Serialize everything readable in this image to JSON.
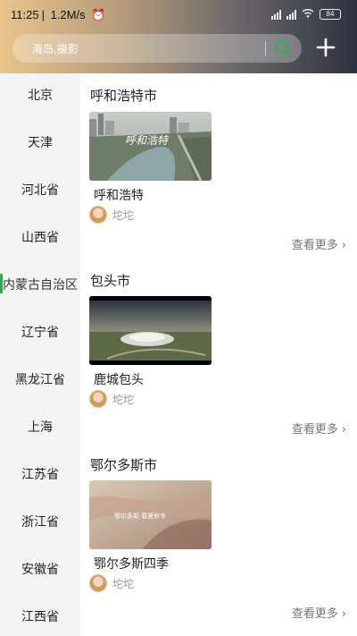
{
  "status": {
    "time": "11:25",
    "speed": "1.2M/s",
    "battery": "84"
  },
  "search": {
    "placeholder": "海岛,摄影"
  },
  "sidebar": {
    "items": [
      {
        "label": "北京"
      },
      {
        "label": "天津"
      },
      {
        "label": "河北省"
      },
      {
        "label": "山西省"
      },
      {
        "label": "内蒙古自治区"
      },
      {
        "label": "辽宁省"
      },
      {
        "label": "黑龙江省"
      },
      {
        "label": "上海"
      },
      {
        "label": "江苏省"
      },
      {
        "label": "浙江省"
      },
      {
        "label": "安徽省"
      },
      {
        "label": "江西省"
      }
    ],
    "active_index": 4
  },
  "sections": [
    {
      "title": "呼和浩特市",
      "card": {
        "title": "呼和浩特",
        "author": "坨坨",
        "thumb_text": "呼和浩特"
      },
      "more": "查看更多"
    },
    {
      "title": "包头市",
      "card": {
        "title": "鹿城包头",
        "author": "坨坨",
        "thumb_text": ""
      },
      "more": "查看更多"
    },
    {
      "title": "鄂尔多斯市",
      "card": {
        "title": "鄂尔多斯四季",
        "author": "坨坨",
        "thumb_text": "鄂尔多斯·春夏秋冬"
      },
      "more": "查看更多"
    }
  ],
  "colors": {
    "accent": "#3aa55a",
    "search_icon": "#2fb24f"
  }
}
